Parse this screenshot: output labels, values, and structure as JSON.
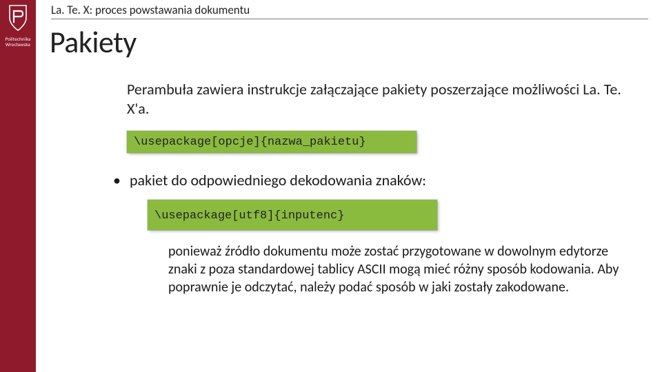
{
  "brand": {
    "line1": "Politechnika",
    "line2": "Wrocławska"
  },
  "breadcrumb": "La. Te. X: proces powstawania dokumentu",
  "title": "Pakiety",
  "intro": "Perambuła zawiera instrukcje załączające pakiety poszerzające możliwości La. Te. X'a.",
  "code1": "\\usepackage[opcje]{nazwa_pakietu}",
  "bullet1": "pakiet do odpowiedniego dekodowania znaków:",
  "code2": "\\usepackage[utf8]{inputenc}",
  "explain": "ponieważ źródło dokumentu może zostać przygotowane w dowolnym edytorze znaki z poza standardowej tablicy ASCII mogą mieć różny sposób kodowania. Aby poprawnie je odczytać, należy podać sposób w jaki zostały zakodowane."
}
